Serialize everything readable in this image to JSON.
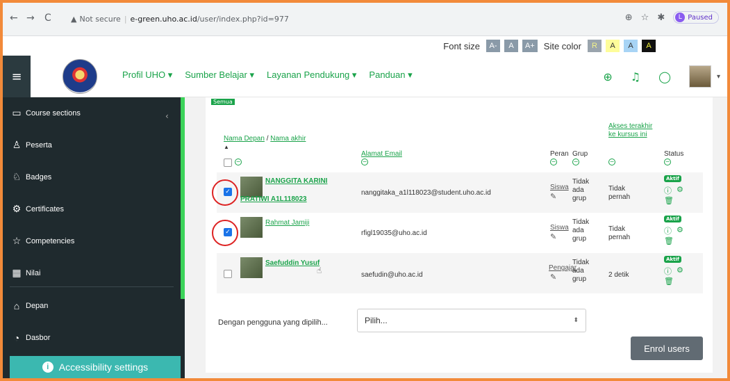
{
  "browser": {
    "security": "Not secure",
    "url_host": "e-green.uho.ac.id",
    "url_path": "/user/index.php?id=977",
    "profile_status": "Paused",
    "profile_initial": "L"
  },
  "accessibility_bar": {
    "font_size_label": "Font size",
    "font_buttons": [
      "A-",
      "A",
      "A+"
    ],
    "site_color_label": "Site color",
    "color_buttons": [
      "R",
      "A",
      "A",
      "A"
    ]
  },
  "navbar": {
    "menu": [
      {
        "label": "Profil UHO ▾"
      },
      {
        "label": "Sumber Belajar ▾"
      },
      {
        "label": "Layanan Pendukung ▾"
      },
      {
        "label": "Panduan ▾"
      }
    ]
  },
  "sidebar": {
    "items": [
      {
        "label": "Course sections",
        "icon": "folder-icon"
      },
      {
        "label": "Peserta",
        "icon": "users-icon"
      },
      {
        "label": "Badges",
        "icon": "badge-icon"
      },
      {
        "label": "Certificates",
        "icon": "certificate-icon"
      },
      {
        "label": "Competencies",
        "icon": "star-icon"
      },
      {
        "label": "Nilai",
        "icon": "grades-icon"
      },
      {
        "label": "Depan",
        "icon": "home-icon"
      },
      {
        "label": "Dasbor",
        "icon": "dashboard-icon"
      }
    ],
    "accessibility_button": "Accessibility settings"
  },
  "table": {
    "alphabet_all": "Semua",
    "headers": {
      "first_name": "Nama Depan",
      "slash": " / ",
      "last_name": "Nama akhir",
      "email": "Alamat Email",
      "role": "Peran",
      "group": "Grup",
      "last_access": "Akses terakhir ke kursus ini",
      "status": "Status"
    },
    "rows": [
      {
        "name_line1": "NANGGITA KARINI",
        "name_line2": "PRATIWI A1L118023",
        "email": "nanggitaka_a1l118023@student.uho.ac.id",
        "role": "Siswa",
        "group": "Tidak ada grup",
        "last_access": "Tidak pernah",
        "status": "Aktif",
        "checked": true
      },
      {
        "name_line1": "Rahmat Jamiji",
        "name_line2": "",
        "email": "rfigl19035@uho.ac.id",
        "role": "Siswa",
        "group": "Tidak ada grup",
        "last_access": "Tidak pernah",
        "status": "Aktif",
        "checked": true
      },
      {
        "name_line1": "Saefuddin Yusuf",
        "name_line2": "",
        "email": "saefudin@uho.ac.id",
        "role": "Pengajar",
        "group": "Tidak ada grup",
        "last_access": "2 detik",
        "status": "Aktif",
        "checked": false
      }
    ]
  },
  "bulk": {
    "label": "Dengan pengguna yang dipilih...",
    "select_value": "Pilih..."
  },
  "enrol_button": "Enrol users",
  "colors": {
    "accent_green": "#1aa34a",
    "sidebar_bg": "#1f2a2e",
    "highlight_red": "#d22222",
    "frame_orange": "#f28a3a"
  }
}
